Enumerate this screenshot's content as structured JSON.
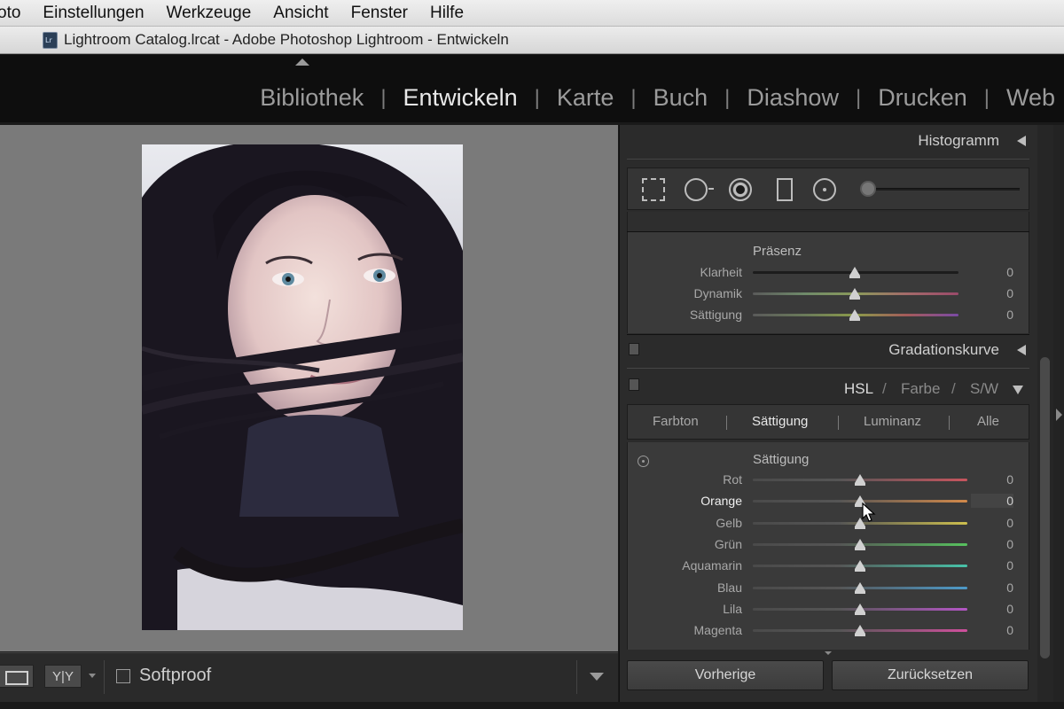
{
  "menubar": {
    "items": [
      "oto",
      "Einstellungen",
      "Werkzeuge",
      "Ansicht",
      "Fenster",
      "Hilfe"
    ]
  },
  "window": {
    "title": "Lightroom Catalog.lrcat - Adobe Photoshop Lightroom - Entwickeln"
  },
  "modules": {
    "items": [
      "Bibliothek",
      "Entwickeln",
      "Karte",
      "Buch",
      "Diashow",
      "Drucken",
      "Web"
    ],
    "active": "Entwickeln",
    "separator": "|"
  },
  "toolbar": {
    "yy_label": "Y|Y",
    "softproof_label": "Softproof",
    "softproof_checked": false
  },
  "panel": {
    "histogram_title": "Histogramm",
    "presence": {
      "title": "Präsenz",
      "sliders": [
        {
          "label": "Klarheit",
          "value": "0",
          "gradient": "neutral"
        },
        {
          "label": "Dynamik",
          "value": "0",
          "gradient": "vibrance"
        },
        {
          "label": "Sättigung",
          "value": "0",
          "gradient": "saturation"
        }
      ]
    },
    "tone_curve_title": "Gradationskurve",
    "hsl_header": {
      "hsl": "HSL",
      "slash": "/",
      "farbe": "Farbe",
      "sw": "S/W"
    },
    "hsl_tabs": [
      "Farbton",
      "Sättigung",
      "Luminanz",
      "Alle"
    ],
    "hsl_tab_active": "Sättigung",
    "saturation": {
      "title": "Sättigung",
      "sliders": [
        {
          "label": "Rot",
          "value": "0",
          "color": "#c8555e"
        },
        {
          "label": "Orange",
          "value": "0",
          "color": "#d2894a"
        },
        {
          "label": "Gelb",
          "value": "0",
          "color": "#cdbf4e"
        },
        {
          "label": "Grün",
          "value": "0",
          "color": "#57c15e"
        },
        {
          "label": "Aquamarin",
          "value": "0",
          "color": "#47c3a9"
        },
        {
          "label": "Blau",
          "value": "0",
          "color": "#4d9ac9"
        },
        {
          "label": "Lila",
          "value": "0",
          "color": "#b456c6"
        },
        {
          "label": "Magenta",
          "value": "0",
          "color": "#d0509d"
        }
      ],
      "hovered": "Orange"
    },
    "buttons": {
      "previous": "Vorherige",
      "reset": "Zurücksetzen"
    }
  },
  "colors": {
    "panel_bg": "#2b2b2b",
    "canvas_bg": "#7a7a7a",
    "module_active": "#e9e9e9",
    "module_inactive": "#9b9b9b"
  }
}
